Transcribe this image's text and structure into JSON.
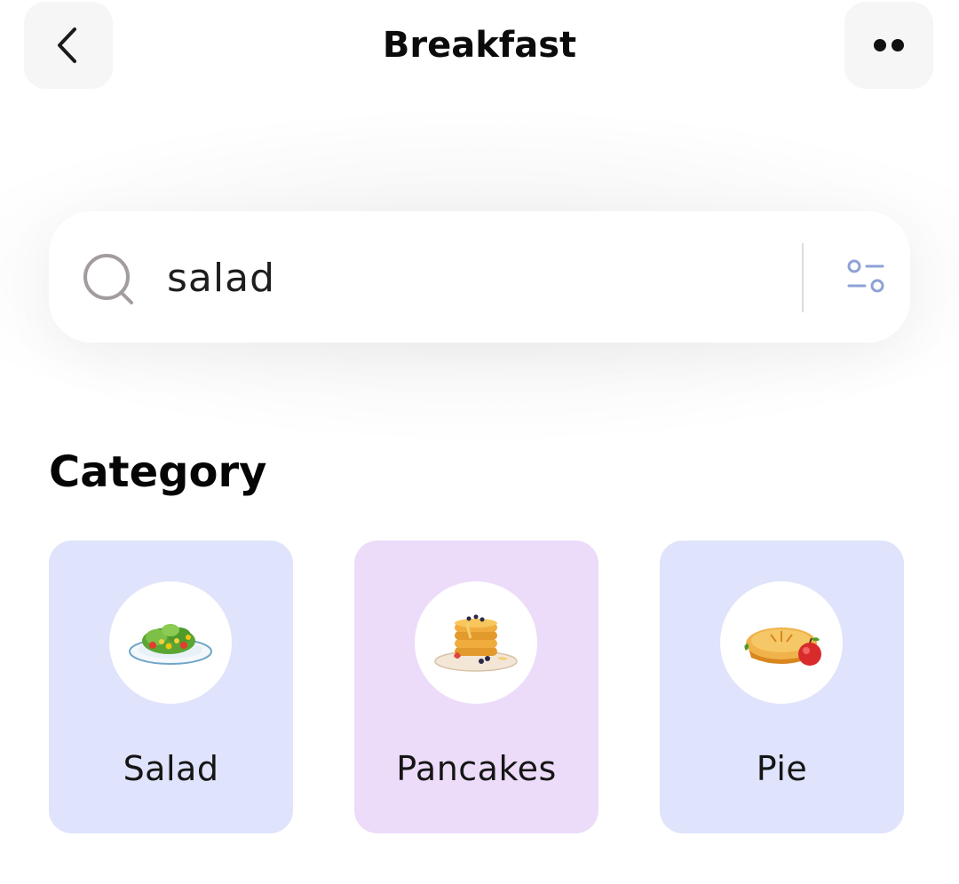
{
  "header": {
    "title": "Breakfast",
    "back_icon": "chevron-left-icon",
    "more_icon": "more-dots-icon"
  },
  "search": {
    "value": "salad",
    "search_icon": "search-icon",
    "filter_icon": "filter-sliders-icon"
  },
  "category": {
    "title": "Category",
    "items": [
      {
        "label": "Salad",
        "icon": "salad-plate-icon",
        "bg": "#dfe3fb"
      },
      {
        "label": "Pancakes",
        "icon": "pancakes-icon",
        "bg": "#ecdcf9"
      },
      {
        "label": "Pie",
        "icon": "pie-icon",
        "bg": "#dfe3fb"
      }
    ]
  },
  "colors": {
    "button_bg": "#f5f6f5",
    "filter_accent": "#8ea2d6",
    "search_icon": "#a39c9d"
  }
}
